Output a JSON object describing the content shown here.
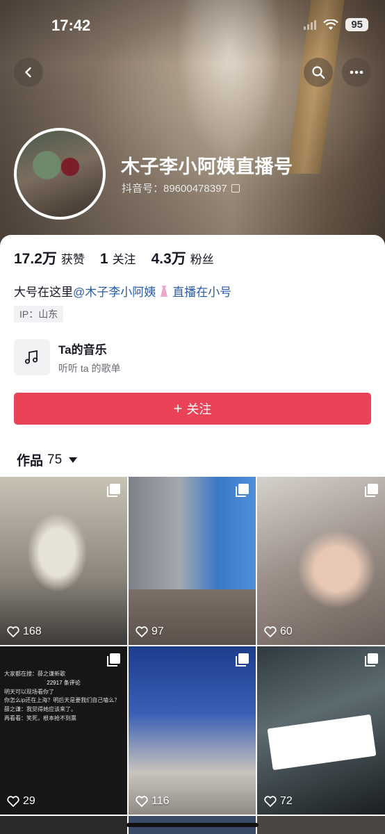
{
  "status": {
    "time": "17:42",
    "battery": "95"
  },
  "profile": {
    "nickname": "木子李小阿姨直播号",
    "douyin_id": "抖音号：89600478397"
  },
  "stats": [
    {
      "num": "17.2万",
      "label": "获赞"
    },
    {
      "num": "1",
      "label": "关注"
    },
    {
      "num": "4.3万",
      "label": "粉丝"
    }
  ],
  "bio": {
    "prefix": "大号在这里",
    "mention": "@木子李小阿姨",
    "suffix": "直播在小号"
  },
  "ip": "IP：山东",
  "music": {
    "title": "Ta的音乐",
    "subtitle": "听听 ta 的歌单"
  },
  "follow": {
    "label": "关注"
  },
  "works": {
    "label": "作品",
    "count": "75"
  },
  "grid": [
    {
      "likes": "168"
    },
    {
      "likes": "97"
    },
    {
      "likes": "60"
    },
    {
      "likes": "29"
    },
    {
      "likes": "116"
    },
    {
      "likes": "72"
    }
  ],
  "comment_panel": {
    "header": "22917 条评论",
    "search": "大家都在搜：薛之谦新歌",
    "lines": [
      "明天可以现场看你了",
      "你怎么ip还在上海？明后天是要我们自己嗑么？",
      "薛之谦：我觉得她应该来了。",
      "再看看：笑死，根本抢不到票"
    ]
  },
  "colors": {
    "accent": "#ea4358",
    "link": "#2a5caa"
  },
  "icons": [
    "back-icon",
    "search-icon",
    "more-icon",
    "music-note-icon",
    "copy-icon",
    "heart-icon",
    "multi-image-icon",
    "dropdown-triangle-icon"
  ]
}
